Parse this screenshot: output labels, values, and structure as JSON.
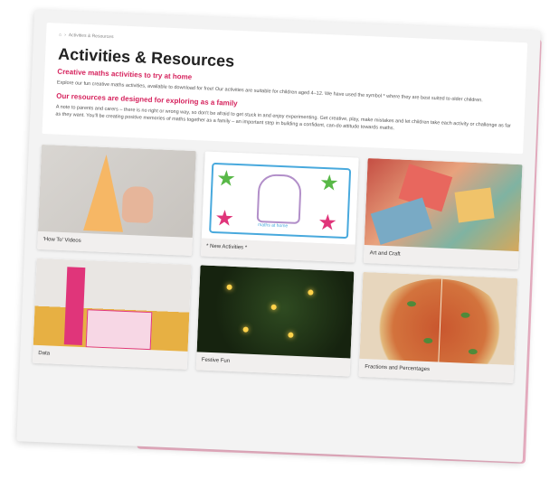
{
  "breadcrumb": {
    "home_icon": "home-icon",
    "items": [
      "Activities & Resources"
    ]
  },
  "page": {
    "title": "Activities & Resources",
    "subhead_1": "Creative maths activities to try at home",
    "para_1": "Explore our fun creative maths activities, available to download for free! Our activities are suitable for children aged 4–12. We have used the symbol * where they are best suited to older children.",
    "subhead_2": "Our resources are designed for exploring as a family",
    "para_2": "A note to parents and carers – there is no right or wrong way, so don't be afraid to get stuck in and enjoy experimenting. Get creative, play, make mistakes and let children take each activity or challenge as far as they want. You'll be creating positive memories of maths together as a family – an important step in building a confident, can-do attitude towards maths."
  },
  "tiles": [
    {
      "label": "'How To' Videos"
    },
    {
      "label": "* New Activities *"
    },
    {
      "label": "Art and Craft"
    },
    {
      "label": "Data"
    },
    {
      "label": "Festive Fun"
    },
    {
      "label": "Fractions and Percentages"
    }
  ],
  "new_activities_logo": "maths at home",
  "colors": {
    "accent": "#d6245e",
    "pink_backing": "#f3b7cb",
    "logo_blue": "#48a9dd"
  }
}
